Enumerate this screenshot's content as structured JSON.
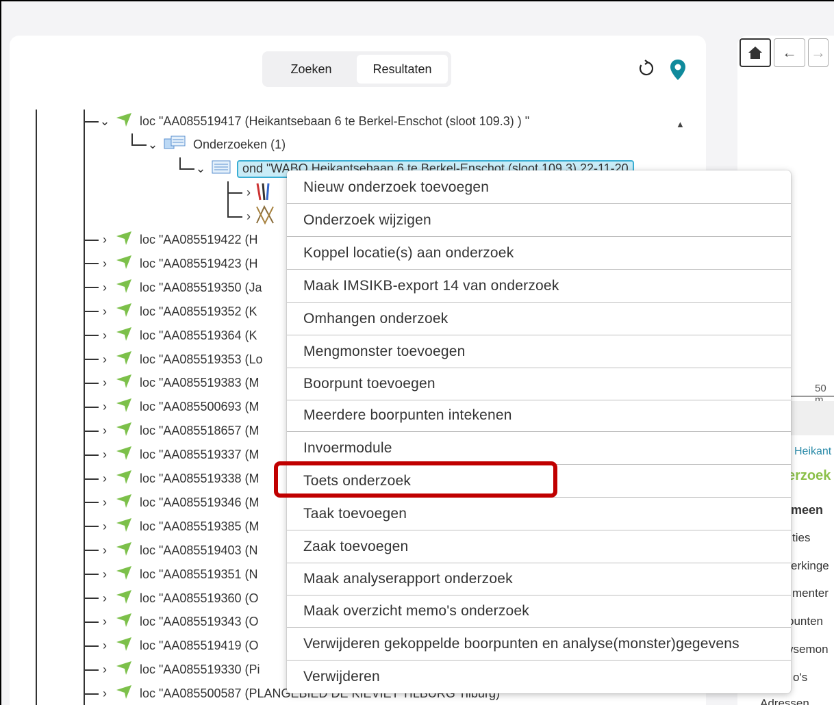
{
  "tabs": [
    {
      "label": "Zoeken",
      "active": false
    },
    {
      "label": "Resultaten",
      "active": true
    }
  ],
  "icons": {
    "refresh": "refresh-icon",
    "location": "location-pin-icon",
    "home": "home-icon",
    "back": "arrow-left-icon",
    "forward": "arrow-right-icon"
  },
  "colors": {
    "accent": "#0f8a9c",
    "flag": "#7cc04a",
    "selection": "#c9ecf7",
    "highlight": "#c00000"
  },
  "tree": {
    "root": {
      "label": "loc \"AA085519417 (Heikantsebaan 6 te Berkel-Enschot (sloot 109.3) ) \""
    },
    "group": {
      "label": "Onderzoeken (1)"
    },
    "selected": {
      "label": "ond \"WABO Heikantsebaan 6 te Berkel-Enschot (sloot 109.3) 22-11-20"
    },
    "locations": [
      "loc \"AA085519422 (H",
      "loc \"AA085519423 (H",
      "loc \"AA085519350 (Ja",
      "loc \"AA085519352 (K",
      "loc \"AA085519364 (K",
      "loc \"AA085519353 (Lo",
      "loc \"AA085519383 (M",
      "loc \"AA085500693 (M",
      "loc \"AA085518657 (M",
      "loc \"AA085519337 (M",
      "loc \"AA085519338 (M",
      "loc \"AA085519346 (M",
      "loc \"AA085519385 (M",
      "loc \"AA085519403 (N",
      "loc \"AA085519351 (N",
      "loc \"AA085519360 (O",
      "loc \"AA085519343 (O",
      "loc \"AA085519419 (O",
      "loc \"AA085519330 (Pi",
      "loc \"AA085500587 (PLANGEBIED DE KIEVIET TILBURG Tilburg)"
    ]
  },
  "context_menu": {
    "items": [
      "Nieuw onderzoek toevoegen",
      "Onderzoek wijzigen",
      "Koppel locatie(s) aan onderzoek",
      "Maak IMSIKB-export 14 van onderzoek",
      "Omhangen onderzoek",
      "Mengmonster toevoegen",
      "Boorpunt toevoegen",
      "Meerdere boorpunten intekenen",
      "Invoermodule",
      "Toets onderzoek",
      "Taak toevoegen",
      "Zaak toevoegen",
      "Maak analyserapport onderzoek",
      "Maak overzicht memo's onderzoek",
      "Verwijderen gekoppelde boorpunten en analyse(monster)gegevens",
      "Verwijderen"
    ],
    "highlighted": "Toets onderzoek"
  },
  "right_panel": {
    "scale": "50 m",
    "link": "Heikant",
    "heading": "erzoek",
    "section": "meen",
    "rows": [
      "ties",
      "erkinge",
      "menter",
      "ounten",
      "ysemon",
      "o's",
      "Adressen"
    ]
  }
}
